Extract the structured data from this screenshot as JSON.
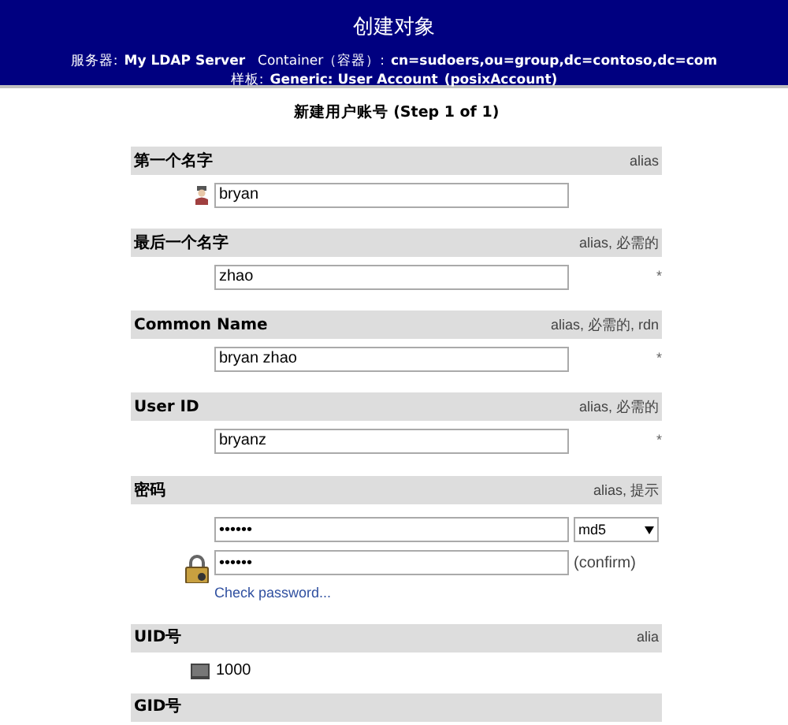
{
  "header": {
    "title": "创建对象",
    "server_label": "服务器:",
    "server": "My LDAP Server",
    "container_label": "Container（容器）:",
    "container": "cn=sudoers,ou=group,dc=contoso,dc=com",
    "template_label": "样板:",
    "template": "Generic: User Account",
    "template_class": "(posixAccount)"
  },
  "form_title": "新建用户账号 (Step 1 of 1)",
  "attributes": [
    {
      "kind": "text",
      "label": "第一个名字",
      "hints": "alias",
      "value": "bryan"
    },
    {
      "kind": "text",
      "label": "最后一个名字",
      "hints": "alias, 必需的",
      "value": "zhao",
      "required_mark": "*"
    },
    {
      "kind": "text",
      "label": "Common Name",
      "hints": "alias, 必需的, rdn",
      "value": "bryan zhao",
      "required_mark": "*"
    },
    {
      "kind": "text",
      "label": "User ID",
      "hints": "alias, 必需的",
      "value": "bryanz",
      "required_mark": "*"
    },
    {
      "kind": "password",
      "label": "密码",
      "hints": "alias, 提示",
      "value": "••••••",
      "confirm_value": "••••••",
      "hash": "md5",
      "confirm_label": "(confirm)",
      "check_link": "Check password..."
    },
    {
      "kind": "number",
      "label": "UID号",
      "hints": "alia",
      "value": "1000"
    },
    {
      "kind": "header_only",
      "label": "GID号"
    }
  ]
}
